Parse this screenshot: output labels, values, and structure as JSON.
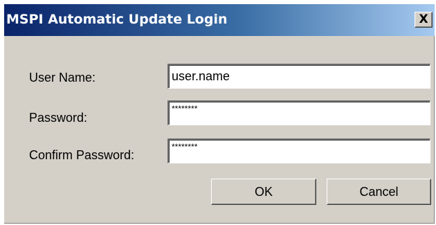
{
  "window": {
    "title": "MSPI Automatic Update Login",
    "close_glyph": "X"
  },
  "form": {
    "username_label": "User Name:",
    "username_value": "user.name",
    "password_label": "Password:",
    "password_value": "********",
    "confirm_label": "Confirm Password:",
    "confirm_value": "********"
  },
  "buttons": {
    "ok_label": "OK",
    "cancel_label": "Cancel"
  },
  "colors": {
    "title_gradient_start": "#0a246a",
    "title_gradient_end": "#a6caf0",
    "dialog_face": "#d4d0c8"
  },
  "icons": {
    "close": "close-icon"
  }
}
